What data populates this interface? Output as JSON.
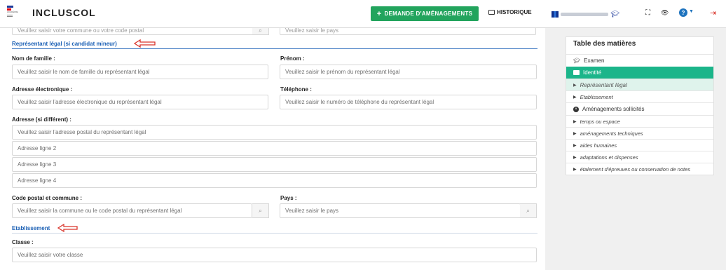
{
  "header": {
    "logo_text": "ACADÉMIE",
    "app_title": "INCLUSCOL",
    "demande_label": "DEMANDE D'AMÉNAGEMENTS",
    "historique_label": "HISTORIQUE",
    "expand_icon": "⛶",
    "eye_icon": "👁",
    "help_icon": "?",
    "logout_icon": "⇥"
  },
  "form": {
    "top_clip": {
      "commune_placeholder": "Veuillez saisir votre commune ou votre code postal",
      "pays_placeholder": "Veuillez saisir le pays"
    },
    "representant": {
      "title": "Représentant légal (si candidat mineur)",
      "nom_label": "Nom de famille :",
      "nom_placeholder": "Veuillez saisir le nom de famille du représentant légal",
      "prenom_label": "Prénom :",
      "prenom_placeholder": "Veuillez saisir le prénom du représentant légal",
      "email_label": "Adresse électronique :",
      "email_placeholder": "Veuillez saisir l'adresse électronique du représentant légal",
      "tel_label": "Téléphone :",
      "tel_placeholder": "Veuillez saisir le numéro de téléphone du représentant légal",
      "adresse_label": "Adresse (si différent) :",
      "adresse_placeholder": "Veuillez saisir l'adresse postal du représentant légal",
      "adresse2_placeholder": "Adresse ligne 2",
      "adresse3_placeholder": "Adresse ligne 3",
      "adresse4_placeholder": "Adresse ligne 4",
      "cp_label": "Code postal et commune :",
      "cp_placeholder": "Veuillez saisir la commune ou le code postal du représentant légal",
      "pays_label": "Pays :",
      "pays_placeholder": "Veuillez saisir le pays"
    },
    "etablissement": {
      "title": "Etablissement",
      "classe_label": "Classe :",
      "classe_placeholder": "Veuillez saisir votre classe"
    }
  },
  "toc": {
    "title": "Table des matières",
    "items": [
      {
        "label": "Examen"
      },
      {
        "label": "Identité"
      },
      {
        "label": "Représentant légal"
      },
      {
        "label": "Etablissement"
      },
      {
        "label": "Aménagements sollicités"
      },
      {
        "label": "temps ou espace"
      },
      {
        "label": "aménagements techniques"
      },
      {
        "label": "aides humaines"
      },
      {
        "label": "adaptations et dispenses"
      },
      {
        "label": "étalement d'épreuves ou conservation de notes"
      }
    ]
  },
  "colors": {
    "accent_green": "#22a45d",
    "toc_active": "#1bb58a",
    "section_blue": "#1a5fb4",
    "arrow_red": "#d9342b"
  }
}
